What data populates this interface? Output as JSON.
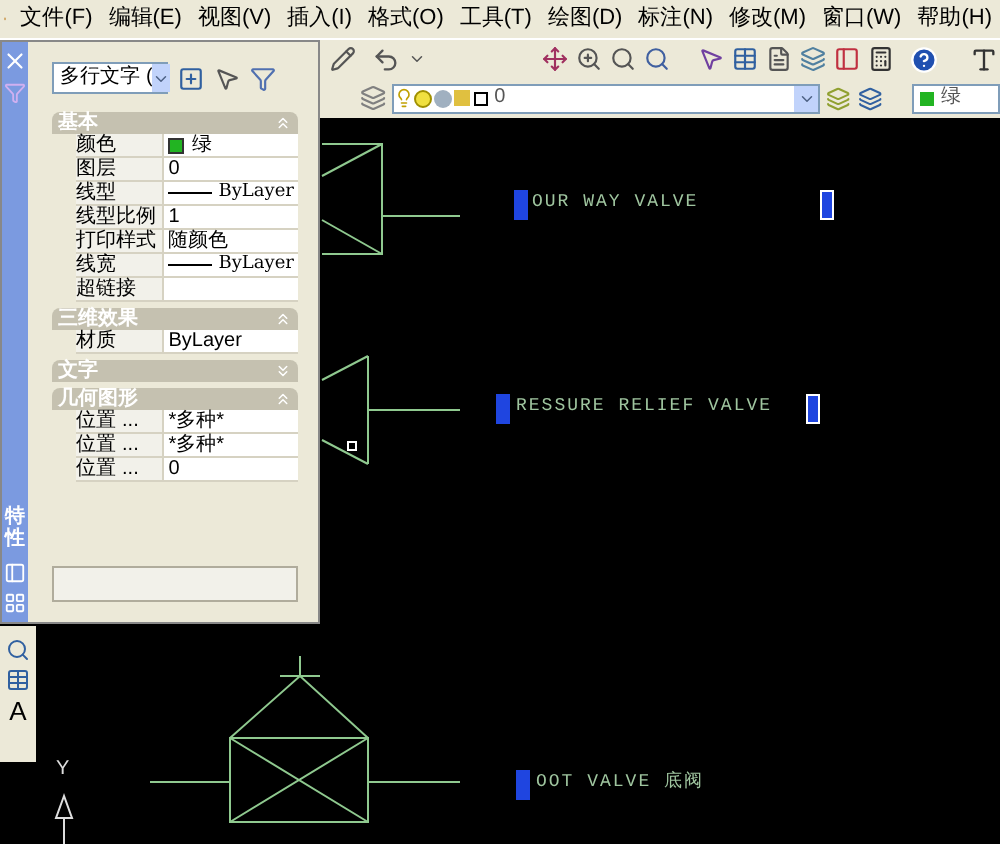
{
  "menu": [
    "文件(F)",
    "编辑(E)",
    "视图(V)",
    "插入(I)",
    "格式(O)",
    "工具(T)",
    "绘图(D)",
    "标注(N)",
    "修改(M)",
    "窗口(W)",
    "帮助(H)"
  ],
  "layer_combo": {
    "value": "0"
  },
  "color_combo": {
    "value": "绿",
    "color": "#22b422"
  },
  "palette": {
    "title": "特性",
    "object_type": "多行文字 (",
    "sections": [
      {
        "title": "基本",
        "expanded": true,
        "rows": [
          {
            "label": "颜色",
            "value": "绿",
            "kind": "swatch",
            "color": "#22b422"
          },
          {
            "label": "图层",
            "value": "0",
            "kind": "text"
          },
          {
            "label": "线型",
            "value": "ByLayer",
            "kind": "line"
          },
          {
            "label": "线型比例",
            "value": "1",
            "kind": "text"
          },
          {
            "label": "打印样式",
            "value": "随颜色",
            "kind": "text"
          },
          {
            "label": "线宽",
            "value": "ByLayer",
            "kind": "line"
          },
          {
            "label": "超链接",
            "kind": "text"
          }
        ]
      },
      {
        "title": "三维效果",
        "expanded": true,
        "rows": [
          {
            "label": "材质",
            "value": "ByLayer",
            "kind": "text"
          }
        ]
      },
      {
        "title": "文字",
        "expanded": false
      },
      {
        "title": "几何图形",
        "expanded": true,
        "rows": [
          {
            "label": "位置 ...",
            "value": "*多种*",
            "kind": "text"
          },
          {
            "label": "位置 ...",
            "value": "*多种*",
            "kind": "text"
          },
          {
            "label": "位置 ...",
            "value": "0",
            "kind": "text"
          }
        ]
      }
    ]
  },
  "left_toolbar": {
    "text_tool": "A"
  },
  "canvas": {
    "labels": [
      "OUR WAY VALVE",
      "RESSURE RELIEF VALVE",
      "OOT VALVE 底阀"
    ],
    "ucs_axis": "Y"
  }
}
